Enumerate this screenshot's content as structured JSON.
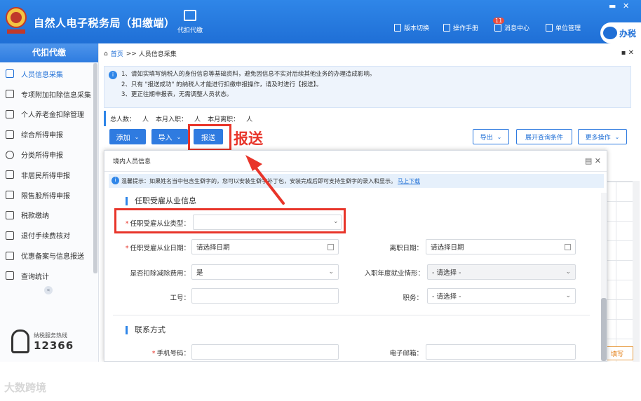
{
  "app": {
    "title": "自然人电子税务局（扣缴端）",
    "top_nav": "代扣代缴",
    "tools": [
      "版本切换",
      "操作手册",
      "消息中心",
      "单位管理"
    ],
    "message_badge": "11",
    "help": "办税",
    "window_controls": [
      "▬",
      "✕"
    ]
  },
  "sidebar": {
    "header": "代扣代缴",
    "items": [
      {
        "label": "人员信息采集",
        "icon": "person-icon"
      },
      {
        "label": "专项附加扣除信息采集",
        "icon": "grid-icon"
      },
      {
        "label": "个人养老金扣除管理",
        "icon": "document-icon"
      },
      {
        "label": "综合所得申报",
        "icon": "layers-icon"
      },
      {
        "label": "分类所得申报",
        "icon": "pie-icon"
      },
      {
        "label": "非居民所得申报",
        "icon": "person-icon"
      },
      {
        "label": "限售股所得申报",
        "icon": "bar-chart-icon"
      },
      {
        "label": "税款缴纳",
        "icon": "folder-icon"
      },
      {
        "label": "退付手续费核对",
        "icon": "ledger-icon"
      },
      {
        "label": "优惠备案与信息报送",
        "icon": "report-icon"
      },
      {
        "label": "查询统计",
        "icon": "search-chart-icon"
      }
    ],
    "collapse": "«",
    "hotline_caption": "纳税服务热线",
    "hotline_number": "12366"
  },
  "breadcrumb": {
    "home": "首页",
    "separator": ">>",
    "current": "人员信息采集",
    "actions": "▪ ✕"
  },
  "notice": {
    "lines": [
      "1、请如实填写纳税人的身份信息等基础资料，避免因信息不实对后续其他业务的办理造成影响。",
      "2、只有 \"报送成功\" 的纳税人才能进行扣缴申报操作，请及时进行【报送】。",
      "3、更正往期申报表，无需调整人员状态。"
    ]
  },
  "stats": {
    "total_label": "总人数：",
    "total_unit": "人",
    "new_label": "本月入职：",
    "new_unit": "人",
    "left_label": "本月离职：",
    "left_unit": "人"
  },
  "toolbar": {
    "add": "添加",
    "import": "导入",
    "submit": "报送",
    "export": "导出",
    "expand_query": "展开查询条件",
    "more": "更多操作"
  },
  "annotation": {
    "label": "报送"
  },
  "modal": {
    "title": "境内人员信息",
    "controls": "▤  ✕",
    "tip": "温馨提示：如果姓名当中包含生僻字的，您可以安装生僻字补丁包，安装完成后即可支持生僻字的录入和显示。",
    "tip_link": "马上下载",
    "section1": "任职受雇从业信息",
    "section2": "联系方式",
    "fields": {
      "employment_type": {
        "label": "任职受雇从业类型：",
        "value": ""
      },
      "employment_date": {
        "label": "任职受雇从业日期：",
        "placeholder": "请选择日期"
      },
      "leave_date": {
        "label": "离职日期：",
        "placeholder": "请选择日期"
      },
      "deduct_fee": {
        "label": "是否扣除减除费用：",
        "value": "是"
      },
      "entry_employment": {
        "label": "入职年度就业情形：",
        "value": "- 请选择 -"
      },
      "employee_no": {
        "label": "工号：",
        "value": ""
      },
      "position": {
        "label": "职务：",
        "value": "- 请选择 -"
      },
      "phone": {
        "label": "手机号码：",
        "value": ""
      },
      "email": {
        "label": "电子邮箱：",
        "value": ""
      }
    }
  },
  "side_button": "填写",
  "watermark": "大数跨境",
  "colors": {
    "primary": "#2f7be0",
    "highlight": "#e8352a"
  }
}
